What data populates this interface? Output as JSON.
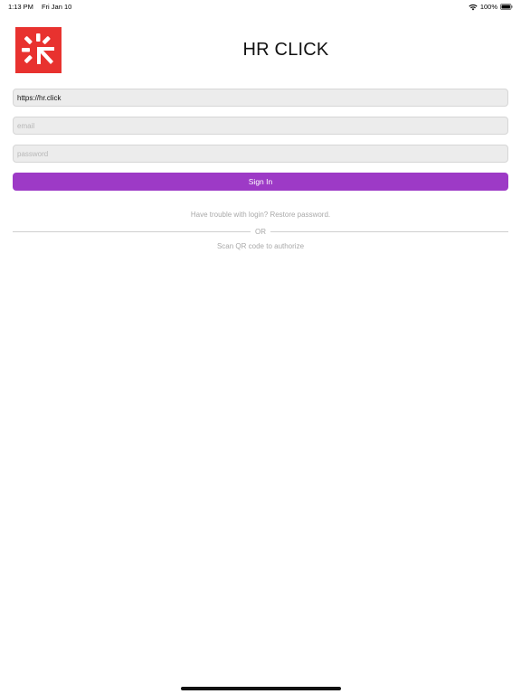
{
  "status_bar": {
    "time": "1:13 PM",
    "date": "Fri Jan 10",
    "battery_percent": "100%",
    "icons": [
      "wifi-icon",
      "battery-icon"
    ]
  },
  "header": {
    "logo_icon": "hr-click-logo",
    "title": "HR CLICK"
  },
  "form": {
    "url_value": "https://hr.click",
    "email_placeholder": "email",
    "password_placeholder": "password",
    "signin_label": "Sign In"
  },
  "links": {
    "trouble": "Have trouble with login? Restore password.",
    "or": "OR",
    "qr": "Scan QR code to authorize"
  },
  "colors": {
    "accent": "#9d3ac6",
    "logo": "#e8322f",
    "muted_text": "#a9a9a9",
    "field_bg": "#ececec"
  }
}
